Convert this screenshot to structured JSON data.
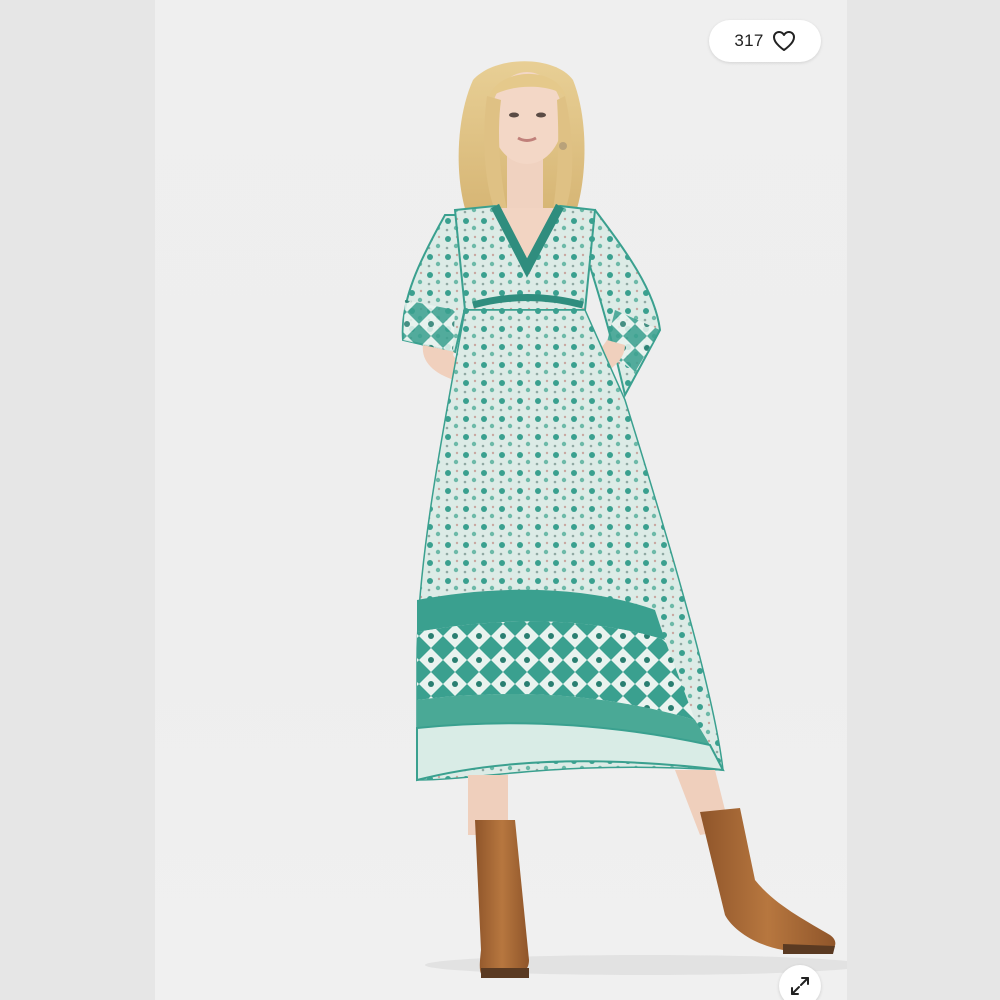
{
  "listing": {
    "like_count": "317",
    "liked": false
  },
  "icons": {
    "like": "heart-outline-icon",
    "expand": "expand-diagonal-icon"
  },
  "colors": {
    "pill_background": "#ffffff",
    "side_background": "#e6e6e6",
    "photo_background": "#efefef",
    "dress_teal": "#3aa08f",
    "boots_tan": "#a86a3a"
  }
}
